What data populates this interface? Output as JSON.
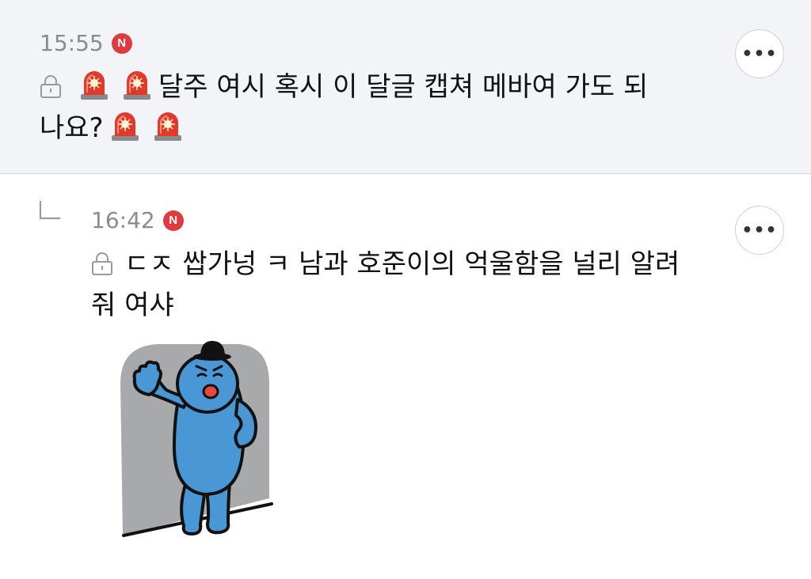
{
  "comments": [
    {
      "time": "15:55",
      "badge": "N",
      "text_line1": "달주 여시 혹시 이 달글 캡쳐 메바여 가도 되",
      "text_line2": "나요?",
      "more": "•••"
    },
    {
      "time": "16:42",
      "badge": "N",
      "text_line1": "ㄷㅈ 쌉가넝 ㅋ 남과 호준이의 억울함을 널리 알려",
      "text_line2": "줘 여샤",
      "more": "•••"
    }
  ],
  "colors": {
    "highlight_bg": "#f2f4f8",
    "badge": "#e0393e",
    "meta": "#8b8b8b",
    "sticker_blue": "#4a97d6"
  },
  "icons": [
    "lock-icon",
    "siren-icon",
    "reply-arrow-icon",
    "more-icon",
    "new-badge"
  ]
}
